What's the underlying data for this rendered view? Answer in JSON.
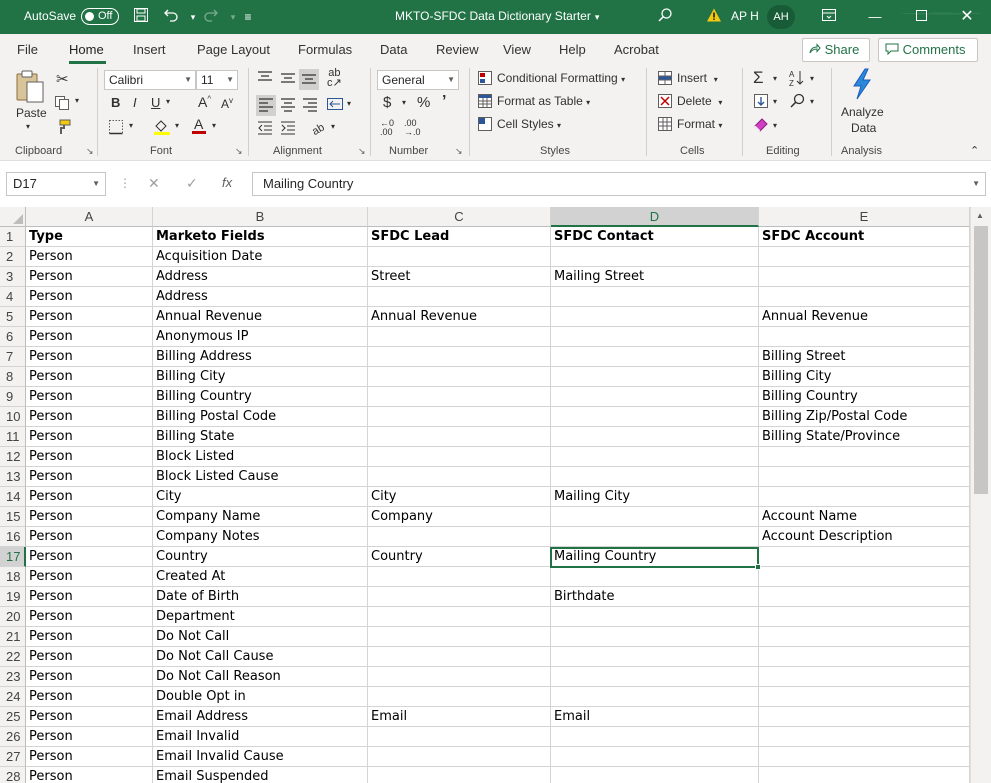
{
  "titlebar": {
    "autosave_label": "AutoSave",
    "autosave_state": "Off",
    "doc_title": "MKTO-SFDC Data Dictionary Starter",
    "user_initials_text": "AP H",
    "avatar_initials": "AH",
    "accent_color": "#217346"
  },
  "tabs": [
    "File",
    "Home",
    "Insert",
    "Page Layout",
    "Formulas",
    "Data",
    "Review",
    "View",
    "Help",
    "Acrobat"
  ],
  "active_tab": "Home",
  "actions": {
    "share": "Share",
    "comments": "Comments"
  },
  "ribbon": {
    "clipboard": {
      "paste": "Paste",
      "label": "Clipboard"
    },
    "font": {
      "name": "Calibri",
      "size": "11",
      "label": "Font"
    },
    "alignment": {
      "label": "Alignment"
    },
    "number": {
      "format": "General",
      "label": "Number"
    },
    "styles": {
      "conditional": "Conditional Formatting",
      "format_table": "Format as Table",
      "cell_styles": "Cell Styles",
      "label": "Styles"
    },
    "cells": {
      "insert": "Insert",
      "delete": "Delete",
      "format": "Format",
      "label": "Cells"
    },
    "editing": {
      "label": "Editing"
    },
    "analysis": {
      "analyze_line1": "Analyze",
      "analyze_line2": "Data",
      "label": "Analysis"
    }
  },
  "formula_bar": {
    "name_box": "D17",
    "content": "Mailing Country"
  },
  "sheet": {
    "columns": [
      "A",
      "B",
      "C",
      "D",
      "E"
    ],
    "selected_column": "D",
    "selected_row": "17",
    "rows": [
      {
        "n": "1",
        "a": "Type",
        "b": "Marketo Fields",
        "c": "SFDC Lead",
        "d": "SFDC Contact",
        "e": "SFDC Account"
      },
      {
        "n": "2",
        "a": "Person",
        "b": "Acquisition Date",
        "c": "",
        "d": "",
        "e": ""
      },
      {
        "n": "3",
        "a": "Person",
        "b": "Address",
        "c": "Street",
        "d": "Mailing Street",
        "e": ""
      },
      {
        "n": "4",
        "a": "Person",
        "b": "Address",
        "c": "",
        "d": "",
        "e": ""
      },
      {
        "n": "5",
        "a": "Person",
        "b": "Annual Revenue",
        "c": "Annual Revenue",
        "d": "",
        "e": "Annual Revenue"
      },
      {
        "n": "6",
        "a": "Person",
        "b": "Anonymous IP",
        "c": "",
        "d": "",
        "e": ""
      },
      {
        "n": "7",
        "a": "Person",
        "b": "Billing Address",
        "c": "",
        "d": "",
        "e": "Billing Street"
      },
      {
        "n": "8",
        "a": "Person",
        "b": "Billing City",
        "c": "",
        "d": "",
        "e": "Billing City"
      },
      {
        "n": "9",
        "a": "Person",
        "b": "Billing Country",
        "c": "",
        "d": "",
        "e": "Billing Country"
      },
      {
        "n": "10",
        "a": "Person",
        "b": "Billing Postal Code",
        "c": "",
        "d": "",
        "e": "Billing Zip/Postal Code"
      },
      {
        "n": "11",
        "a": "Person",
        "b": "Billing State",
        "c": "",
        "d": "",
        "e": "Billing State/Province"
      },
      {
        "n": "12",
        "a": "Person",
        "b": "Block Listed",
        "c": "",
        "d": "",
        "e": ""
      },
      {
        "n": "13",
        "a": "Person",
        "b": "Block Listed Cause",
        "c": "",
        "d": "",
        "e": ""
      },
      {
        "n": "14",
        "a": "Person",
        "b": "City",
        "c": "City",
        "d": "Mailing City",
        "e": ""
      },
      {
        "n": "15",
        "a": "Person",
        "b": "Company Name",
        "c": "Company",
        "d": "",
        "e": "Account Name"
      },
      {
        "n": "16",
        "a": "Person",
        "b": "Company Notes",
        "c": "",
        "d": "",
        "e": "Account Description"
      },
      {
        "n": "17",
        "a": "Person",
        "b": "Country",
        "c": "Country",
        "d": "Mailing Country",
        "e": ""
      },
      {
        "n": "18",
        "a": "Person",
        "b": "Created At",
        "c": "",
        "d": "",
        "e": ""
      },
      {
        "n": "19",
        "a": "Person",
        "b": "Date of Birth",
        "c": "",
        "d": "Birthdate",
        "e": ""
      },
      {
        "n": "20",
        "a": "Person",
        "b": "Department",
        "c": "",
        "d": "",
        "e": ""
      },
      {
        "n": "21",
        "a": "Person",
        "b": "Do Not Call",
        "c": "",
        "d": "",
        "e": ""
      },
      {
        "n": "22",
        "a": "Person",
        "b": "Do Not Call Cause",
        "c": "",
        "d": "",
        "e": ""
      },
      {
        "n": "23",
        "a": "Person",
        "b": "Do Not Call Reason",
        "c": "",
        "d": "",
        "e": ""
      },
      {
        "n": "24",
        "a": "Person",
        "b": "Double Opt in",
        "c": "",
        "d": "",
        "e": ""
      },
      {
        "n": "25",
        "a": "Person",
        "b": "Email Address",
        "c": "Email",
        "d": "Email",
        "e": ""
      },
      {
        "n": "26",
        "a": "Person",
        "b": "Email Invalid",
        "c": "",
        "d": "",
        "e": ""
      },
      {
        "n": "27",
        "a": "Person",
        "b": "Email Invalid Cause",
        "c": "",
        "d": "",
        "e": ""
      },
      {
        "n": "28",
        "a": "Person",
        "b": "Email Suspended",
        "c": "",
        "d": "",
        "e": ""
      }
    ]
  }
}
